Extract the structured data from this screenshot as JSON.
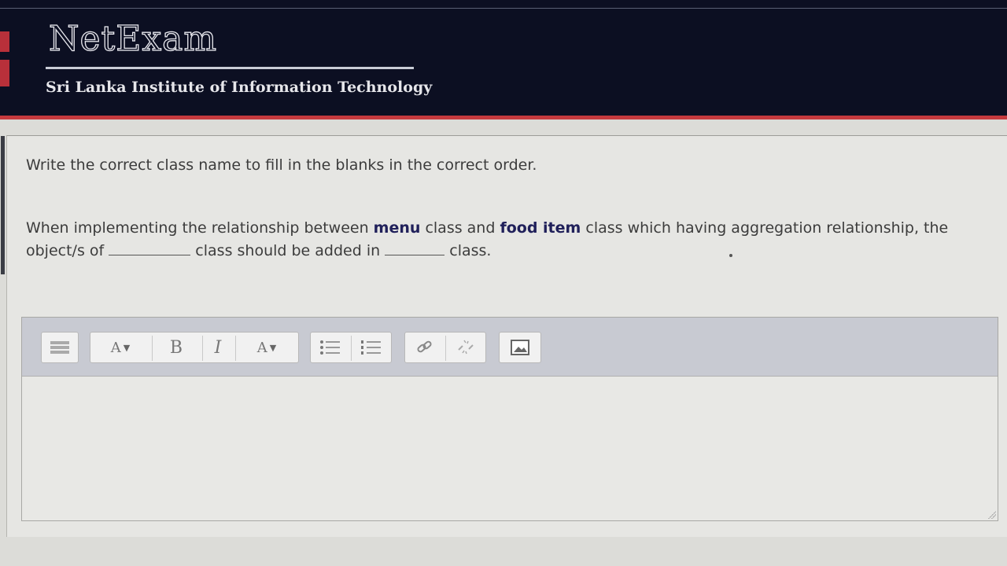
{
  "header": {
    "brand": "NetExam",
    "institute": "Sri Lanka Institute of Information Technology"
  },
  "question": {
    "prompt": "Write the correct class name to fill in the blanks in the correct order.",
    "line1_part1": "When implementing the relationship between ",
    "bold1": "menu",
    "line1_part2": " class and ",
    "bold2": "food item",
    "line1_part3": " class  which having aggregation relationship, the",
    "line2_part1": "object/s of",
    "line2_part2": " class should be added in ",
    "line2_part3": " class."
  },
  "toolbar": {
    "font_size_label": "A",
    "bold_label": "B",
    "italic_label": "I",
    "font_color_label": "A"
  },
  "answer": {
    "value": ""
  }
}
